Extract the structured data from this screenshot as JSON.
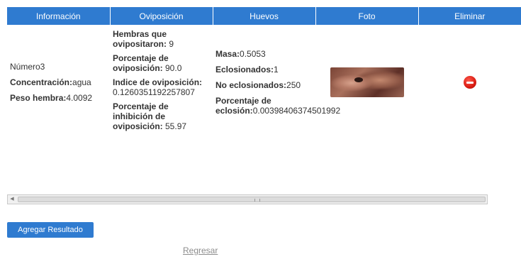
{
  "table": {
    "headers": {
      "informacion": "Información",
      "oviposicion": "Oviposición",
      "huevos": "Huevos",
      "foto": "Foto",
      "eliminar": "Eliminar"
    },
    "row": {
      "informacion": {
        "numero": "Número3",
        "concentracion_label": "Concentración:",
        "concentracion_value": "agua",
        "peso_label": "Peso hembra:",
        "peso_value": "4.0092"
      },
      "oviposicion": {
        "hembras_label": "Hembras que ovipositaron:",
        "hembras_value": " 9",
        "porcentaje_label": "Porcentaje de oviposición:",
        "porcentaje_value": " 90.0",
        "indice_label": "Indice de oviposición:",
        "indice_value": "0.1260351192257807",
        "inhibicion_label": "Porcentaje de inhibición de oviposición:",
        "inhibicion_value": " 55.97"
      },
      "huevos": {
        "masa_label": "Masa:",
        "masa_value": "0.5053",
        "eclosionados_label": "Eclosionados:",
        "eclosionados_value": "1",
        "no_eclosionados_label": "No eclosionados:",
        "no_eclosionados_value": "250",
        "porcentaje_label": "Porcentaje de eclosión:",
        "porcentaje_value": "0.00398406374501992"
      },
      "foto_icon": "photo-thumbnail",
      "eliminar_icon": "delete-icon"
    }
  },
  "actions": {
    "add_result": "Agregar Resultado",
    "back": "Regresar"
  },
  "colors": {
    "header_bg": "#2f7bd0",
    "button_bg": "#2f7bd0",
    "delete_red": "#d91c12"
  }
}
